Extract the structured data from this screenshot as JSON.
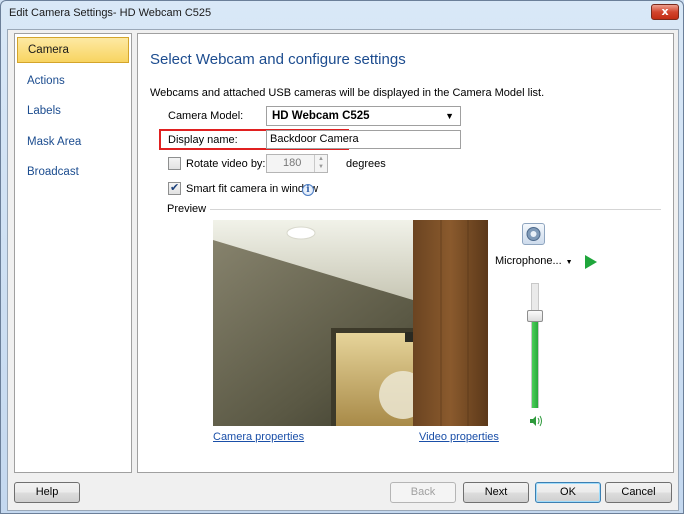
{
  "window": {
    "title": "Edit Camera Settings- HD Webcam C525",
    "close_label": "x"
  },
  "sidebar": {
    "items": [
      {
        "label": "Camera",
        "active": true
      },
      {
        "label": "Actions",
        "active": false
      },
      {
        "label": "Labels",
        "active": false
      },
      {
        "label": "Mask Area",
        "active": false
      },
      {
        "label": "Broadcast",
        "active": false
      }
    ]
  },
  "main": {
    "heading": "Select Webcam and configure settings",
    "description": "Webcams and attached USB cameras will be displayed in the Camera Model list.",
    "camera_model": {
      "label": "Camera Model:",
      "value": "HD Webcam C525"
    },
    "display_name": {
      "label": "Display name:",
      "value": "Backdoor Camera"
    },
    "rotate": {
      "label": "Rotate video by:",
      "checked": false,
      "value": "180",
      "unit": "degrees"
    },
    "smart_fit": {
      "label": "Smart fit camera in window",
      "checked": true
    },
    "preview": {
      "label": "Preview",
      "camera_properties_link": "Camera properties",
      "video_properties_link": "Video properties",
      "microphone_label": "Microphone...",
      "volume_level": 0.69
    }
  },
  "footer": {
    "help": "Help",
    "back": "Back",
    "next": "Next",
    "ok": "OK",
    "cancel": "Cancel"
  },
  "colors": {
    "heading": "#1c4c8f",
    "highlight_border": "#e02020",
    "active_nav": "#f8d461",
    "play": "#1fa63b",
    "link": "#1a4fa8"
  }
}
